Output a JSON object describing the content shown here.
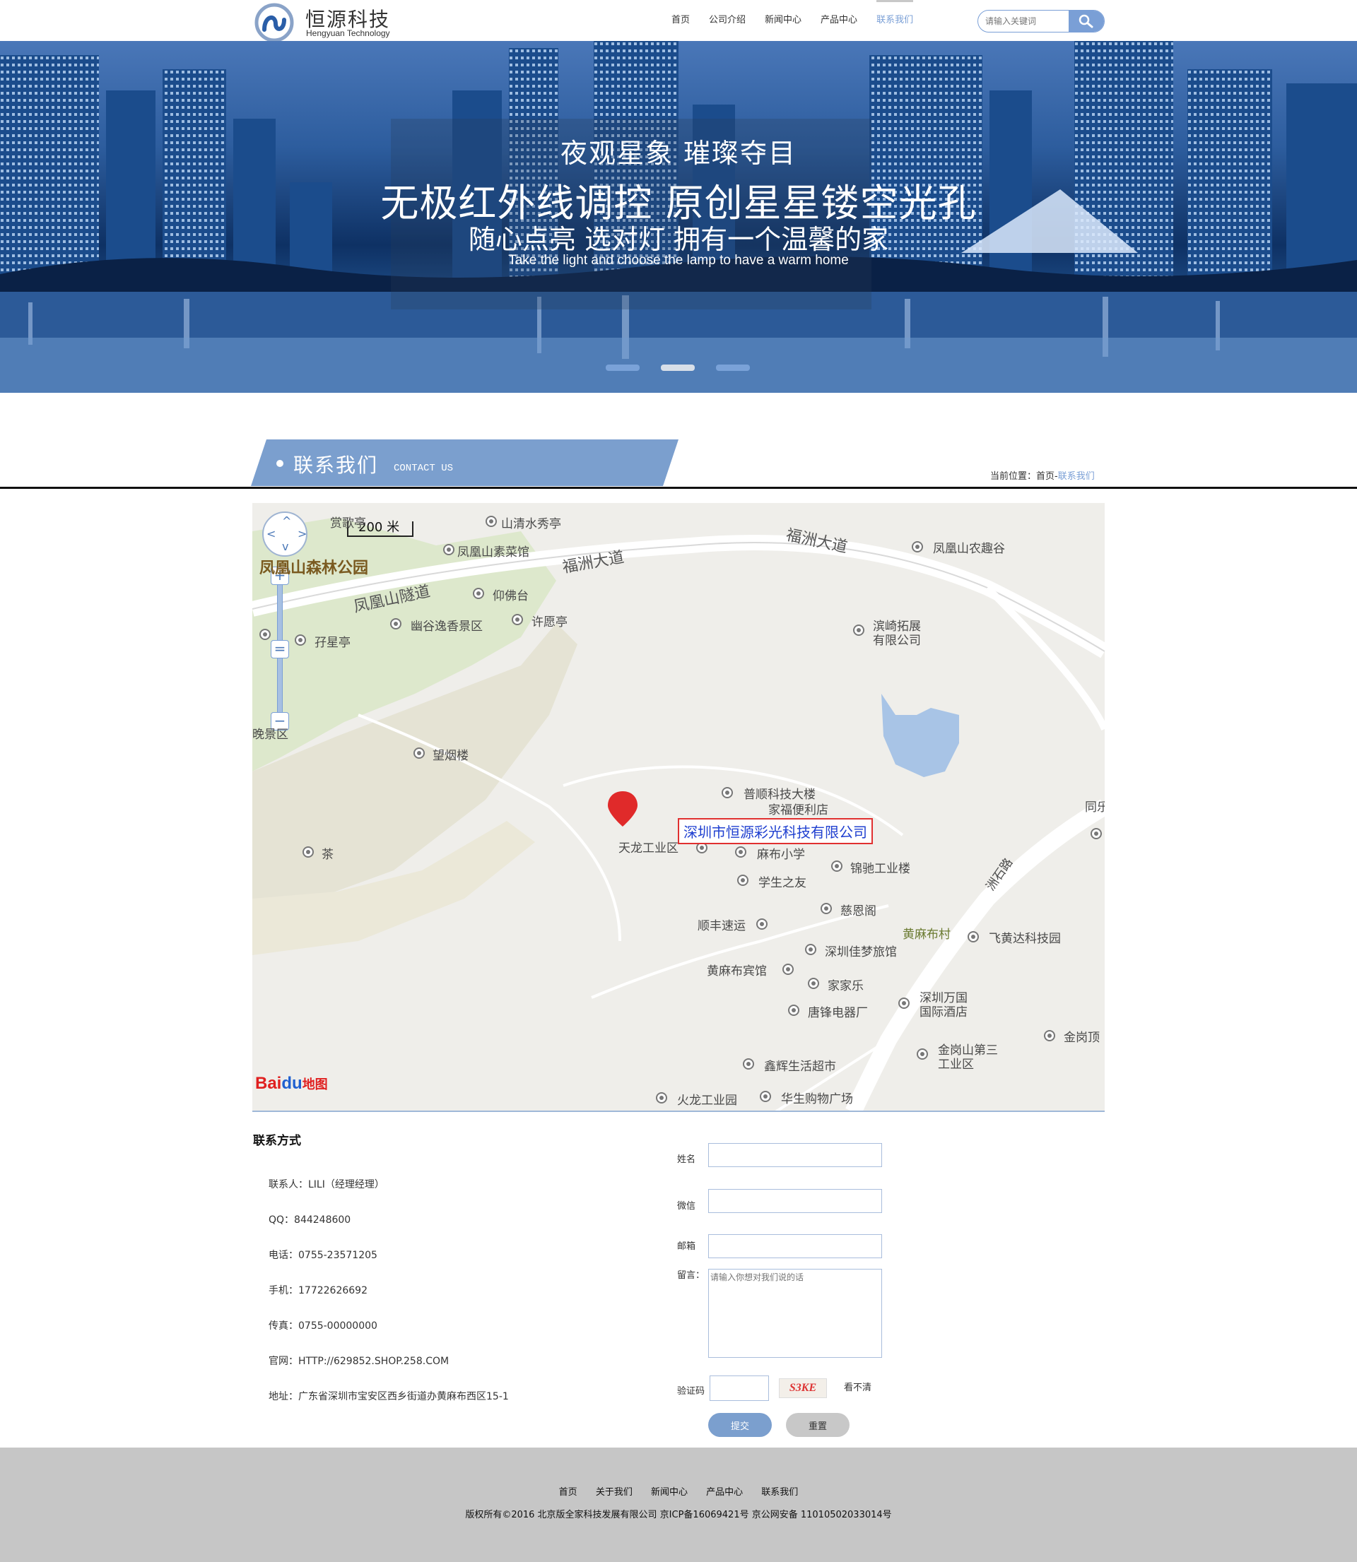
{
  "header": {
    "logo_cn": "恒源科技",
    "logo_en": "Hengyuan Technology",
    "nav": [
      "首页",
      "公司介绍",
      "新闻中心",
      "产品中心",
      "联系我们"
    ],
    "active_nav": "联系我们",
    "search_placeholder": "请输入关键词"
  },
  "banner": {
    "line1": "夜观星象 璀璨夺目",
    "line2": "无极红外线调控 原创星星镂空光孔",
    "line3": "随心点亮 选对灯 拥有一个温馨的家",
    "line4": "Take the light and choose the lamp to have a warm home",
    "slides": 3,
    "active_slide": 2
  },
  "section": {
    "title": "联系我们",
    "subtitle": "CONTACT US",
    "breadcrumb_prefix": "当前位置：首页-",
    "breadcrumb_current": "联系我们"
  },
  "map": {
    "scale": "200 米",
    "company_label": "深圳市恒源彩光科技有限公司",
    "logo": "Baidu地图",
    "labels": [
      "凤凰山森林公园",
      "福洲大道",
      "福洲大道",
      "凤凰山隧道",
      "山清水秀亭",
      "凤凰山素菜馆",
      "凤凰山农趣谷",
      "仰佛台",
      "幽谷逸香景区",
      "许愿亭",
      "孖星亭",
      "滨崎拓展",
      "有限公司",
      "望烟楼",
      "晚景区",
      "普顺科技大楼",
      "家福便利店",
      "天龙工业区",
      "麻布小学",
      "锦驰工业楼",
      "学生之友",
      "茶",
      "慈恩阁",
      "顺丰速运",
      "黄麻布村",
      "飞黄达科技园",
      "深圳佳梦旅馆",
      "黄麻布宾馆",
      "家家乐",
      "深圳万国",
      "国际酒店",
      "唐锋电器厂",
      "金岗顶",
      "金岗山第三",
      "工业区",
      "鑫辉生活超市",
      "火龙工业园",
      "华生购物广场",
      "洲石路",
      "同乐",
      "赏歌亭"
    ]
  },
  "contact": {
    "heading": "联系方式",
    "rows": [
      "联系人：LILI（经理经理）",
      "QQ：844248600",
      "电话：0755-23571205",
      "手机：17722626692",
      "传真：0755-00000000",
      "官网：HTTP://629852.SHOP.258.COM",
      "地址：广东省深圳市宝安区西乡街道办黄麻布西区15-1"
    ]
  },
  "form": {
    "name_label": "姓名",
    "wechat_label": "微信",
    "email_label": "邮箱",
    "message_label": "留言：",
    "message_placeholder": "请输入你想对我们说的话",
    "captcha_label": "验证码",
    "captcha_text": "S3KE",
    "refresh_label": "看不清",
    "submit_label": "提交",
    "reset_label": "重置"
  },
  "footer": {
    "nav": [
      "首页",
      "关于我们",
      "新闻中心",
      "产品中心",
      "联系我们"
    ],
    "copyright": "版权所有©2016  北京版全家科技发展有限公司  京ICP备16069421号    京公网安备  11010502033014号"
  },
  "colors": {
    "accent": "#7a9fd6",
    "banner_dark": "#0e3164",
    "footer_bg": "#c6c6c6"
  }
}
